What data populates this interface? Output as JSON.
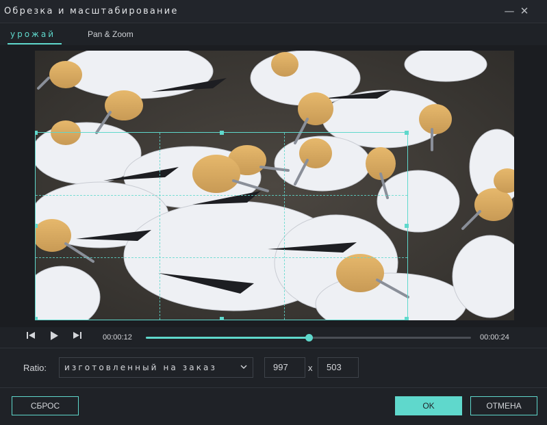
{
  "window": {
    "title": "Обрезка и масштабирование",
    "minimize_icon": "minimize-icon",
    "close_icon": "close-icon"
  },
  "tabs": [
    {
      "label": "урожай",
      "active": true
    },
    {
      "label": "Pan & Zoom",
      "active": false
    }
  ],
  "player": {
    "current_time": "00:00:12",
    "total_time": "00:00:24",
    "progress": 0.5,
    "icons": [
      "prev-frame-icon",
      "play-icon",
      "next-frame-icon"
    ]
  },
  "ratio": {
    "label": "Ratio:",
    "selected": "изготовленный на заказ",
    "width": "997",
    "separator": "x",
    "height": "503"
  },
  "footer": {
    "reset_label": "СБРОС",
    "ok_label": "OK",
    "cancel_label": "ОТМЕНА"
  },
  "colors": {
    "accent": "#5fd8cc",
    "background": "#1f2227"
  }
}
